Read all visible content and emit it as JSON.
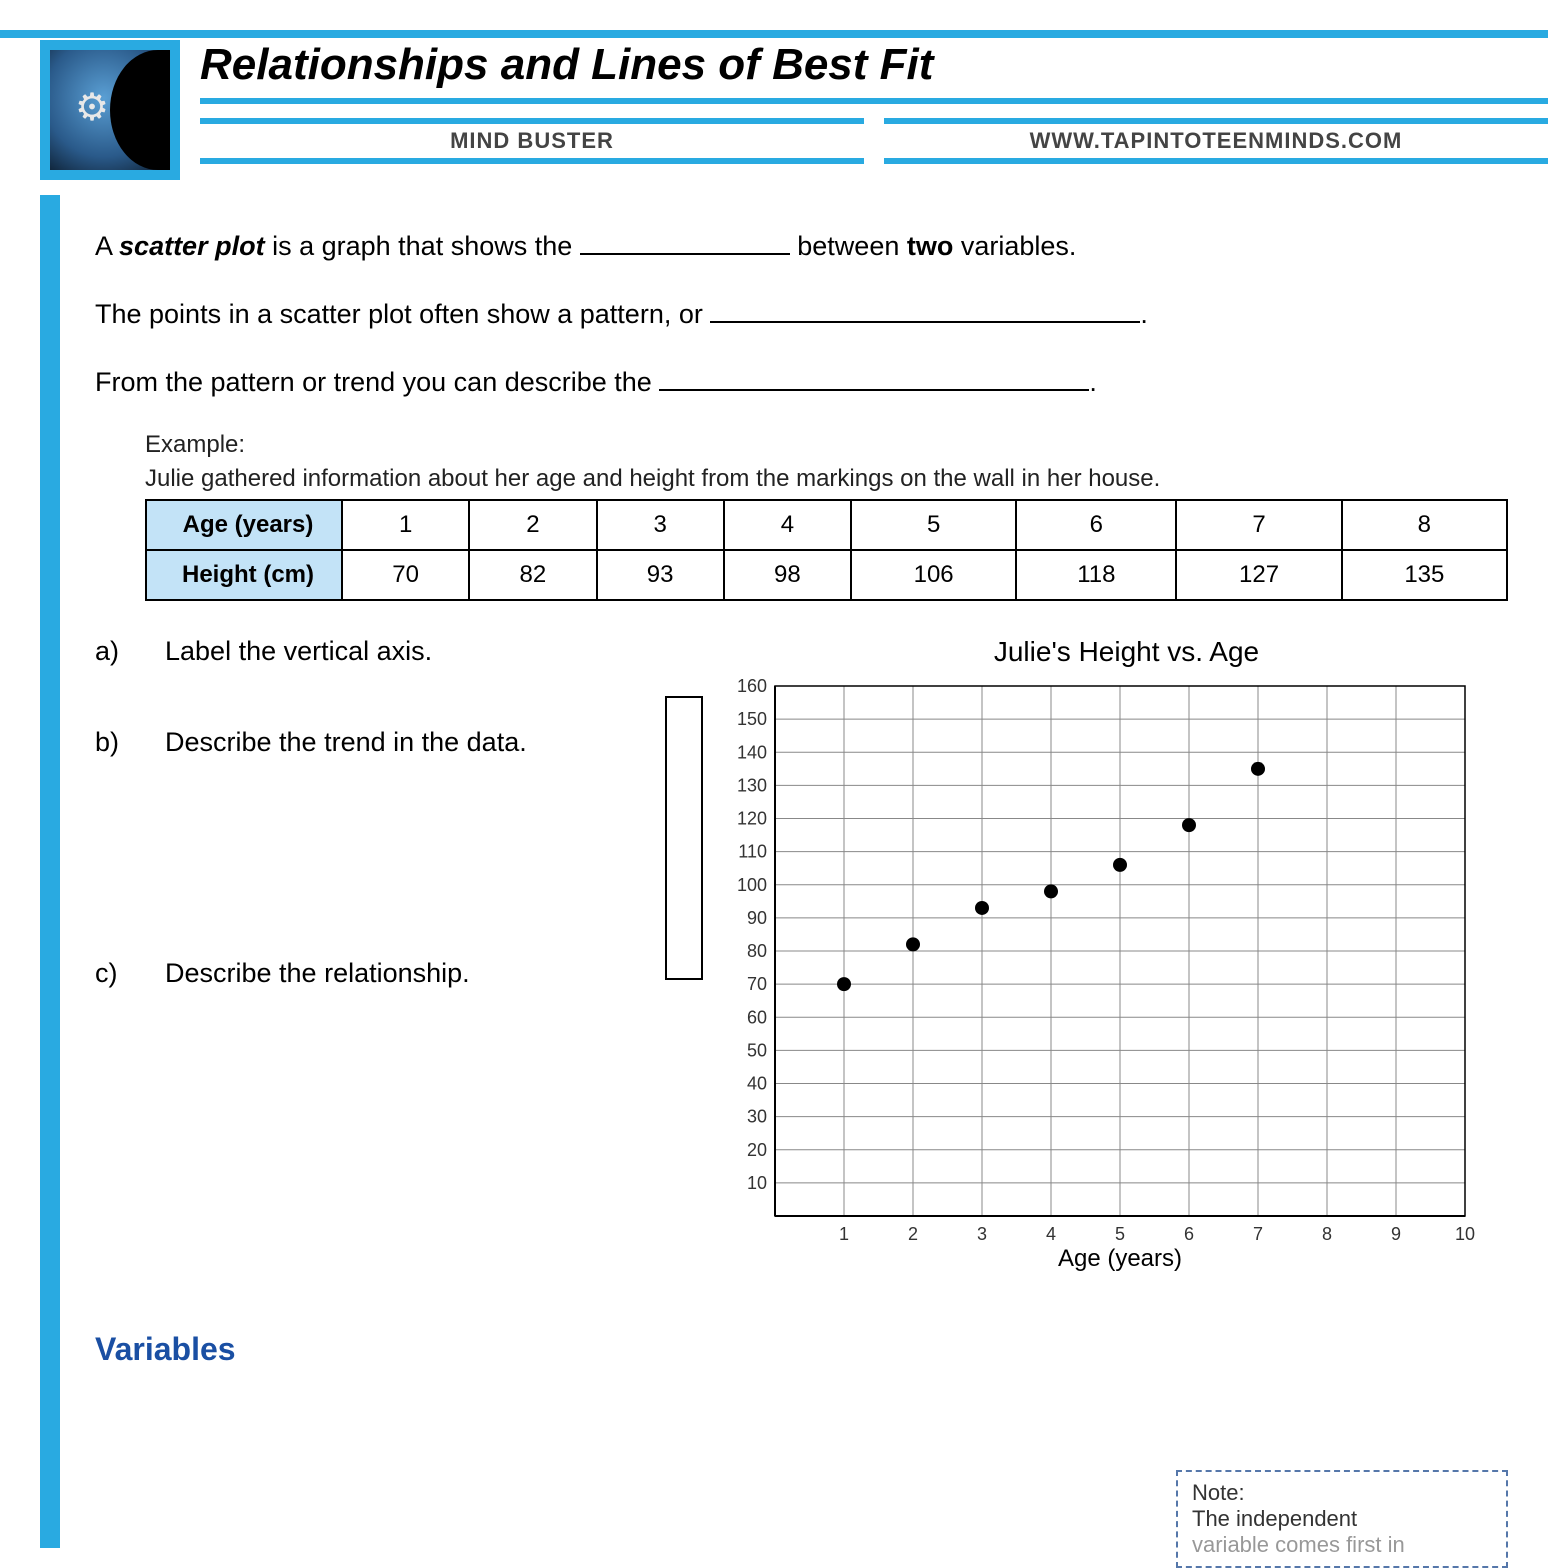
{
  "header": {
    "title": "Relationships and Lines of Best Fit",
    "subLeft": "MIND BUSTER",
    "subRight": "WWW.TAPINTOTEENMINDS.COM"
  },
  "intro": {
    "line1_pre": "A ",
    "line1_em": "scatter plot",
    "line1_mid": " is a graph that shows the ",
    "line1_post": " between ",
    "line1_bold": "two",
    "line1_end": " variables.",
    "line2_pre": "The points in a scatter plot often show a pattern, or ",
    "line2_end": ".",
    "line3_pre": "From the pattern or trend you can describe the ",
    "line3_end": "."
  },
  "example": {
    "label": "Example:",
    "desc": "Julie gathered information about her age and height from the markings on the wall in her house.",
    "row1_header": "Age (years)",
    "row2_header": "Height (cm)",
    "ages": [
      "1",
      "2",
      "3",
      "4",
      "5",
      "6",
      "7",
      "8"
    ],
    "heights": [
      "70",
      "82",
      "93",
      "98",
      "106",
      "118",
      "127",
      "135"
    ]
  },
  "questions": {
    "a": "Label the vertical axis.",
    "b": "Describe the trend in the data.",
    "c": "Describe the relationship."
  },
  "chart_data": {
    "type": "scatter",
    "title": "Julie's Height vs. Age",
    "xlabel": "Age (years)",
    "ylabel": "",
    "x": [
      1,
      2,
      3,
      4,
      5,
      6,
      7
    ],
    "y": [
      70,
      82,
      93,
      98,
      106,
      118,
      135
    ],
    "xlim": [
      0,
      10
    ],
    "ylim": [
      0,
      160
    ],
    "xticks": [
      1,
      2,
      3,
      4,
      5,
      6,
      7,
      8,
      9,
      10
    ],
    "yticks": [
      10,
      20,
      30,
      40,
      50,
      60,
      70,
      80,
      90,
      100,
      110,
      120,
      130,
      140,
      150,
      160
    ]
  },
  "section2": {
    "heading": "Variables"
  },
  "note": {
    "title": "Note:",
    "line1": "The independent",
    "line2": "variable comes first in"
  }
}
